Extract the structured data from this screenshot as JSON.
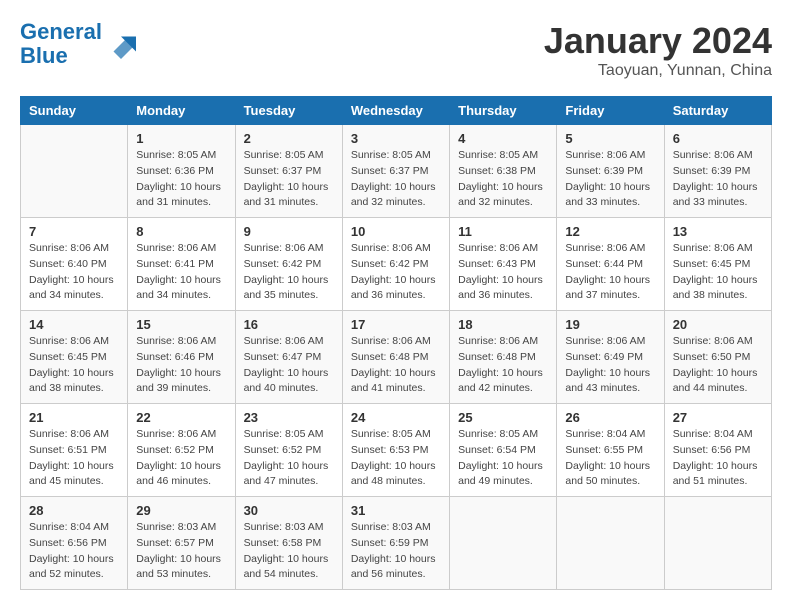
{
  "header": {
    "logo_line1": "General",
    "logo_line2": "Blue",
    "month_title": "January 2024",
    "subtitle": "Taoyuan, Yunnan, China"
  },
  "days_of_week": [
    "Sunday",
    "Monday",
    "Tuesday",
    "Wednesday",
    "Thursday",
    "Friday",
    "Saturday"
  ],
  "weeks": [
    [
      {
        "day": "",
        "sunrise": "",
        "sunset": "",
        "daylight": ""
      },
      {
        "day": "1",
        "sunrise": "8:05 AM",
        "sunset": "6:36 PM",
        "daylight": "10 hours and 31 minutes."
      },
      {
        "day": "2",
        "sunrise": "8:05 AM",
        "sunset": "6:37 PM",
        "daylight": "10 hours and 31 minutes."
      },
      {
        "day": "3",
        "sunrise": "8:05 AM",
        "sunset": "6:37 PM",
        "daylight": "10 hours and 32 minutes."
      },
      {
        "day": "4",
        "sunrise": "8:05 AM",
        "sunset": "6:38 PM",
        "daylight": "10 hours and 32 minutes."
      },
      {
        "day": "5",
        "sunrise": "8:06 AM",
        "sunset": "6:39 PM",
        "daylight": "10 hours and 33 minutes."
      },
      {
        "day": "6",
        "sunrise": "8:06 AM",
        "sunset": "6:39 PM",
        "daylight": "10 hours and 33 minutes."
      }
    ],
    [
      {
        "day": "7",
        "sunrise": "8:06 AM",
        "sunset": "6:40 PM",
        "daylight": "10 hours and 34 minutes."
      },
      {
        "day": "8",
        "sunrise": "8:06 AM",
        "sunset": "6:41 PM",
        "daylight": "10 hours and 34 minutes."
      },
      {
        "day": "9",
        "sunrise": "8:06 AM",
        "sunset": "6:42 PM",
        "daylight": "10 hours and 35 minutes."
      },
      {
        "day": "10",
        "sunrise": "8:06 AM",
        "sunset": "6:42 PM",
        "daylight": "10 hours and 36 minutes."
      },
      {
        "day": "11",
        "sunrise": "8:06 AM",
        "sunset": "6:43 PM",
        "daylight": "10 hours and 36 minutes."
      },
      {
        "day": "12",
        "sunrise": "8:06 AM",
        "sunset": "6:44 PM",
        "daylight": "10 hours and 37 minutes."
      },
      {
        "day": "13",
        "sunrise": "8:06 AM",
        "sunset": "6:45 PM",
        "daylight": "10 hours and 38 minutes."
      }
    ],
    [
      {
        "day": "14",
        "sunrise": "8:06 AM",
        "sunset": "6:45 PM",
        "daylight": "10 hours and 38 minutes."
      },
      {
        "day": "15",
        "sunrise": "8:06 AM",
        "sunset": "6:46 PM",
        "daylight": "10 hours and 39 minutes."
      },
      {
        "day": "16",
        "sunrise": "8:06 AM",
        "sunset": "6:47 PM",
        "daylight": "10 hours and 40 minutes."
      },
      {
        "day": "17",
        "sunrise": "8:06 AM",
        "sunset": "6:48 PM",
        "daylight": "10 hours and 41 minutes."
      },
      {
        "day": "18",
        "sunrise": "8:06 AM",
        "sunset": "6:48 PM",
        "daylight": "10 hours and 42 minutes."
      },
      {
        "day": "19",
        "sunrise": "8:06 AM",
        "sunset": "6:49 PM",
        "daylight": "10 hours and 43 minutes."
      },
      {
        "day": "20",
        "sunrise": "8:06 AM",
        "sunset": "6:50 PM",
        "daylight": "10 hours and 44 minutes."
      }
    ],
    [
      {
        "day": "21",
        "sunrise": "8:06 AM",
        "sunset": "6:51 PM",
        "daylight": "10 hours and 45 minutes."
      },
      {
        "day": "22",
        "sunrise": "8:06 AM",
        "sunset": "6:52 PM",
        "daylight": "10 hours and 46 minutes."
      },
      {
        "day": "23",
        "sunrise": "8:05 AM",
        "sunset": "6:52 PM",
        "daylight": "10 hours and 47 minutes."
      },
      {
        "day": "24",
        "sunrise": "8:05 AM",
        "sunset": "6:53 PM",
        "daylight": "10 hours and 48 minutes."
      },
      {
        "day": "25",
        "sunrise": "8:05 AM",
        "sunset": "6:54 PM",
        "daylight": "10 hours and 49 minutes."
      },
      {
        "day": "26",
        "sunrise": "8:04 AM",
        "sunset": "6:55 PM",
        "daylight": "10 hours and 50 minutes."
      },
      {
        "day": "27",
        "sunrise": "8:04 AM",
        "sunset": "6:56 PM",
        "daylight": "10 hours and 51 minutes."
      }
    ],
    [
      {
        "day": "28",
        "sunrise": "8:04 AM",
        "sunset": "6:56 PM",
        "daylight": "10 hours and 52 minutes."
      },
      {
        "day": "29",
        "sunrise": "8:03 AM",
        "sunset": "6:57 PM",
        "daylight": "10 hours and 53 minutes."
      },
      {
        "day": "30",
        "sunrise": "8:03 AM",
        "sunset": "6:58 PM",
        "daylight": "10 hours and 54 minutes."
      },
      {
        "day": "31",
        "sunrise": "8:03 AM",
        "sunset": "6:59 PM",
        "daylight": "10 hours and 56 minutes."
      },
      {
        "day": "",
        "sunrise": "",
        "sunset": "",
        "daylight": ""
      },
      {
        "day": "",
        "sunrise": "",
        "sunset": "",
        "daylight": ""
      },
      {
        "day": "",
        "sunrise": "",
        "sunset": "",
        "daylight": ""
      }
    ]
  ]
}
